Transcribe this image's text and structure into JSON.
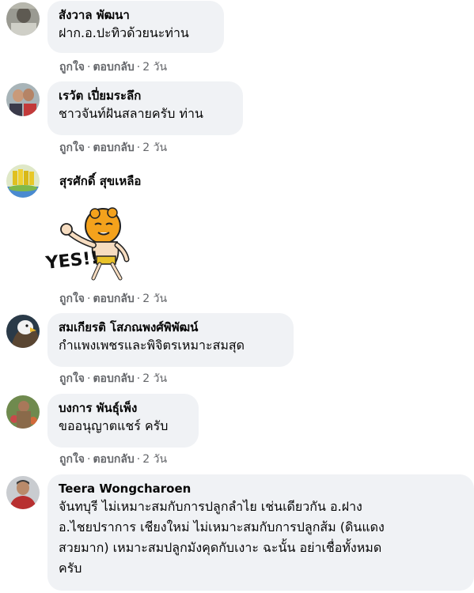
{
  "comments": [
    {
      "name": "สังวาล พัฒนา",
      "text": [
        "ฝาก.อ.ปะทิวด้วยนะท่าน"
      ],
      "like": "ถูกใจ",
      "reply": "ตอบกลับ",
      "time": "2 วัน"
    },
    {
      "name": "เรวัต เปี่ยมระลึก",
      "text": [
        "ชาวจันท์ฝันสลายครับ ท่าน"
      ],
      "like": "ถูกใจ",
      "reply": "ตอบกลับ",
      "time": "2 วัน"
    },
    {
      "name": "สุรศักดิ์ สุขเหลือ",
      "sticker_text": "YES!!",
      "like": "ถูกใจ",
      "reply": "ตอบกลับ",
      "time": "2 วัน"
    },
    {
      "name": "สมเกียรติ โสภณพงศ์พิพัฒน์",
      "text": [
        "กำแพงเพชรและพิจิตรเหมาะสมสุด"
      ],
      "like": "ถูกใจ",
      "reply": "ตอบกลับ",
      "time": "2 วัน"
    },
    {
      "name": "บงการ พันธุ์เพ็ง",
      "text": [
        "ขออนุญาตแชร์ ครับ"
      ],
      "like": "ถูกใจ",
      "reply": "ตอบกลับ",
      "time": "2 วัน"
    },
    {
      "name": "Teera Wongcharoen",
      "text": [
        "จันทบุรี ไม่เหมาะสมกับการปลูกลำไย เช่นเดียวกัน อ.ฝาง",
        "อ.ไชยปราการ เชียงใหม่ ไม่เหมาะสมกับการปลูกส้ม (ดินแดง",
        "สวยมาก) เหมาะสมปลูกมังคุดกับเงาะ ฉะนั้น อย่าเชื่อทั้งหมด",
        "ครับ"
      ]
    }
  ],
  "separator": "·",
  "colors": {
    "bubble": "#f0f2f5",
    "meta": "#65676b",
    "text": "#050505"
  }
}
